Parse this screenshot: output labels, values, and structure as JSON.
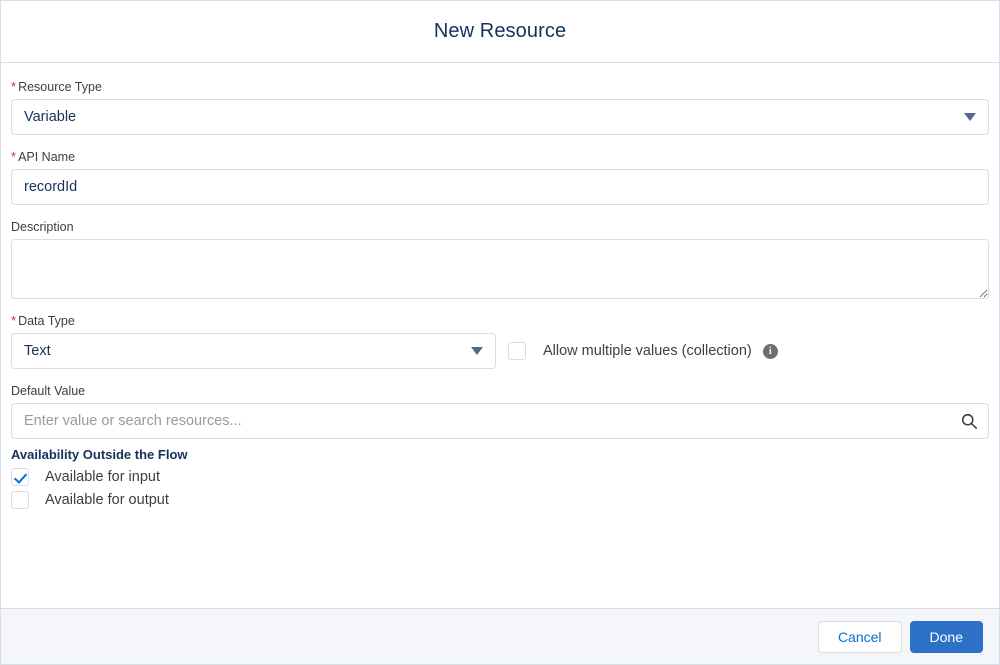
{
  "dialog": {
    "title": "New Resource"
  },
  "fields": {
    "resource_type": {
      "label": "Resource Type",
      "required_marker": "*",
      "value": "Variable",
      "caret_icon": "chevron-down-icon"
    },
    "api_name": {
      "label": "API Name",
      "required_marker": "*",
      "value": "recordId",
      "placeholder": ""
    },
    "description": {
      "label": "Description",
      "value": "",
      "placeholder": ""
    },
    "data_type": {
      "label": "Data Type",
      "required_marker": "*",
      "value": "Text",
      "caret_icon": "chevron-down-icon"
    },
    "allow_multiple": {
      "label": "Allow multiple values (collection)",
      "checked": false,
      "info_icon": "info-icon",
      "info_glyph": "i"
    },
    "default_value": {
      "label": "Default Value",
      "value": "",
      "placeholder": "Enter value or search resources...",
      "search_icon": "search-icon"
    }
  },
  "availability": {
    "title": "Availability Outside the Flow",
    "options": [
      {
        "label": "Available for input",
        "checked": true
      },
      {
        "label": "Available for output",
        "checked": false
      }
    ]
  },
  "footer": {
    "cancel_label": "Cancel",
    "done_label": "Done"
  },
  "colors": {
    "required": "#c23934",
    "brand_blue": "#2d70c7",
    "link_blue": "#0070d2",
    "border": "#d8dde6",
    "footer_bg": "#f4f6f9",
    "text": "#16325c"
  }
}
